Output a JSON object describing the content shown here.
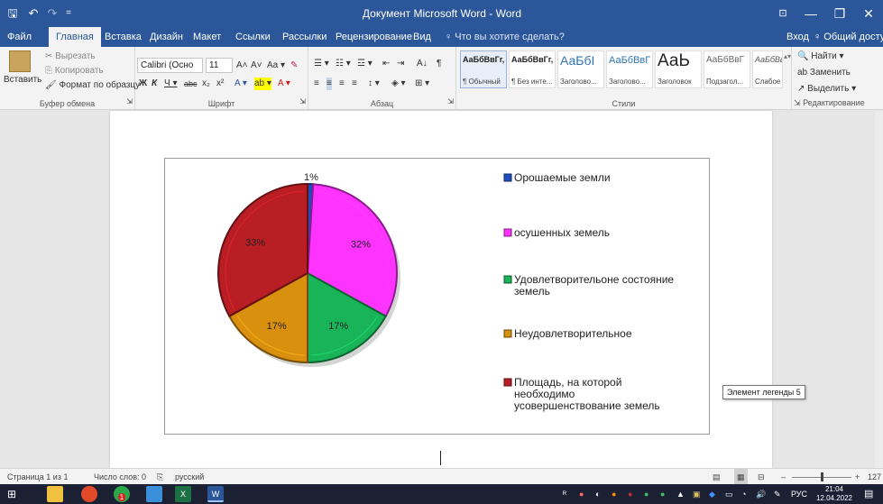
{
  "window": {
    "title": "Документ Microsoft Word - Word",
    "minimize": "—",
    "maximize": "❐",
    "close": "✕",
    "restore_ribbon": "⊡"
  },
  "quick_access": {
    "save": "🖫",
    "undo": "↶",
    "redo": "↷",
    "customize": "="
  },
  "tabs": [
    "Файл",
    "Главная",
    "Вставка",
    "Дизайн",
    "Макет",
    "Ссылки",
    "Рассылки",
    "Рецензирование",
    "Вид"
  ],
  "tell_me": "♀ Что вы хотите сделать?",
  "account": {
    "signin": "Вход",
    "share": "♀ Общий доступ"
  },
  "ribbon": {
    "clipboard": {
      "label": "Буфер обмена",
      "paste": "Вставить",
      "cut": "✂ Вырезать",
      "copy": "⎘ Копировать",
      "format_painter": "🖌 Формат по образцу"
    },
    "font": {
      "label": "Шрифт",
      "font_name": "Calibri (Осно",
      "font_size": "11",
      "grow": "A˄",
      "shrink": "A˅",
      "case": "Aa ▾",
      "bold": "Ж",
      "italic": "К",
      "underline": "Ч ▾",
      "strike": "abc",
      "sub": "x₂",
      "sup": "x²",
      "effects": "A ▾",
      "highlight": "ab ▾",
      "color": "A ▾"
    },
    "paragraph": {
      "label": "Абзац",
      "pilcrow": "¶",
      "sort": "A↓"
    },
    "styles": {
      "label": "Стили",
      "items": [
        {
          "sample": "АаБбВвГг,",
          "name": "¶ Обычный"
        },
        {
          "sample": "АаБбВвГг,",
          "name": "¶ Без инте..."
        },
        {
          "sample": "АаБбI",
          "name": "Заголово..."
        },
        {
          "sample": "АаБбВвГ",
          "name": "Заголово..."
        },
        {
          "sample": "АаЬ",
          "name": "Заголовок"
        },
        {
          "sample": "АаБбВвГ",
          "name": "Подзагол..."
        },
        {
          "sample": "АаБбВвГг",
          "name": "Слабое в..."
        }
      ]
    },
    "editing": {
      "label": "Редактирование",
      "find": "🔍 Найти ▾",
      "replace": "ab Заменить",
      "select": "↗ Выделить ▾"
    },
    "launcher": "⇲"
  },
  "chart_data": {
    "type": "pie",
    "slices": [
      {
        "label": "Орошаемые земли",
        "percent": 1,
        "data_label": "1%",
        "color": "#1f4fbf"
      },
      {
        "label": "осушенных земель",
        "percent": 32,
        "data_label": "32%",
        "color": "#ff33ff"
      },
      {
        "label": "Удовлетворительоне состояние земель",
        "percent": 17,
        "data_label": "17%",
        "color": "#19b458"
      },
      {
        "label": "Неудовлетворительное",
        "percent": 17,
        "data_label": "17%",
        "color": "#d9900f"
      },
      {
        "label": "Площадь, на которой необходимо усовершенствование земель",
        "percent": 33,
        "data_label": "33%",
        "color": "#b81e24"
      }
    ],
    "legend": {
      "placement": "right",
      "lines": [
        [
          "Орошаемые земли"
        ],
        [
          "осушенных земель"
        ],
        [
          "Удовлетворительоне состояние",
          "земель"
        ],
        [
          "Неудовлетворительное"
        ],
        [
          "Площадь, на которой",
          "необходимо",
          "усовершенствование земель"
        ]
      ]
    }
  },
  "tooltip": "Элемент легенды 5",
  "status": {
    "page": "Страница 1 из 1",
    "words": "Число слов: 0",
    "proof": "⎘",
    "language": "русский",
    "zoom": "127"
  },
  "taskbar": {
    "lang": "РУС",
    "time": "21:04",
    "date": "12.04.2022",
    "notification_badge": "1"
  }
}
